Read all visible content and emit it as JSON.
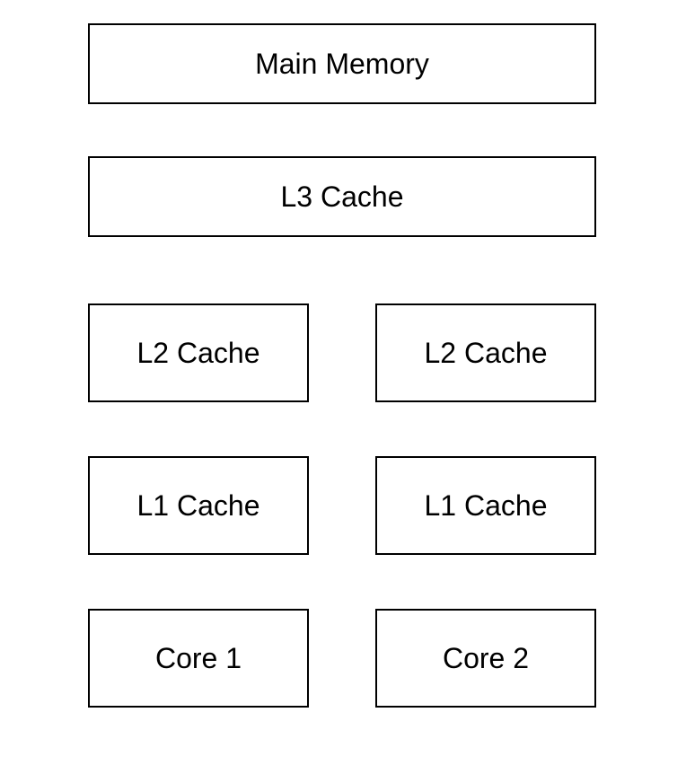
{
  "diagram": {
    "main_memory": "Main Memory",
    "l3_cache": "L3 Cache",
    "left": {
      "l2": "L2 Cache",
      "l1": "L1 Cache",
      "core": "Core 1"
    },
    "right": {
      "l2": "L2 Cache",
      "l1": "L1 Cache",
      "core": "Core 2"
    }
  }
}
